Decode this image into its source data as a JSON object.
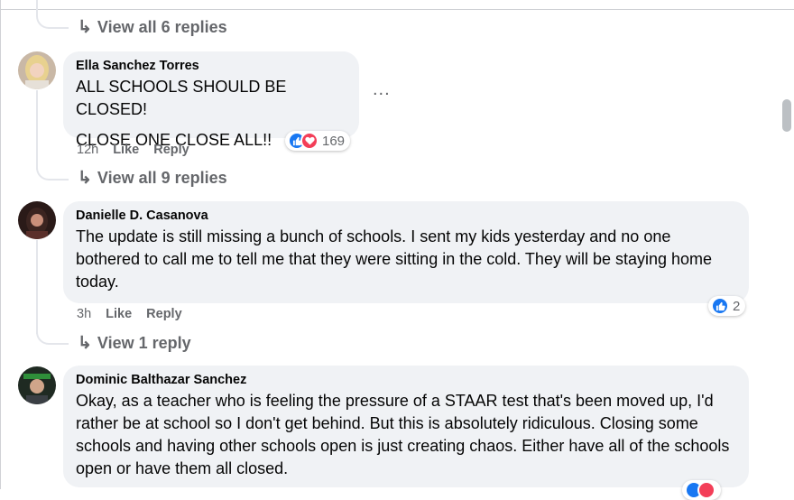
{
  "thread_top": {
    "view_replies": "View all 6 replies"
  },
  "comments": [
    {
      "author": "Ella Sanchez Torres",
      "lines": [
        "ALL SCHOOLS SHOULD BE CLOSED!",
        "CLOSE ONE CLOSE ALL!!"
      ],
      "time": "12h",
      "like": "Like",
      "reply": "Reply",
      "reaction_count": "169",
      "reactions": [
        "like-icon",
        "love-icon"
      ],
      "more": "...",
      "view_replies": "View all 9 replies"
    },
    {
      "author": "Danielle D. Casanova",
      "text": "The update is still missing a bunch of schools. I sent my kids yesterday and no one bothered to call me to tell me that they were sitting in the cold. They will be staying home today.",
      "time": "3h",
      "like": "Like",
      "reply": "Reply",
      "reaction_count": "2",
      "reactions": [
        "like-icon"
      ],
      "view_replies": "View 1 reply"
    },
    {
      "author": "Dominic Balthazar Sanchez",
      "text": "Okay, as a teacher who is feeling the pressure of a STAAR test that's been moved up, I'd rather be at school so I don't get behind. But this is absolutely ridiculous. Closing some schools and having other schools open is just creating chaos. Either have all of the schools open or have them all closed.",
      "reactions": [
        "like-icon",
        "love-icon"
      ]
    }
  ],
  "colors": {
    "like": "#1877f2",
    "love": "#f33e58",
    "bubble": "#f0f2f5",
    "secondary_text": "#65676b"
  }
}
